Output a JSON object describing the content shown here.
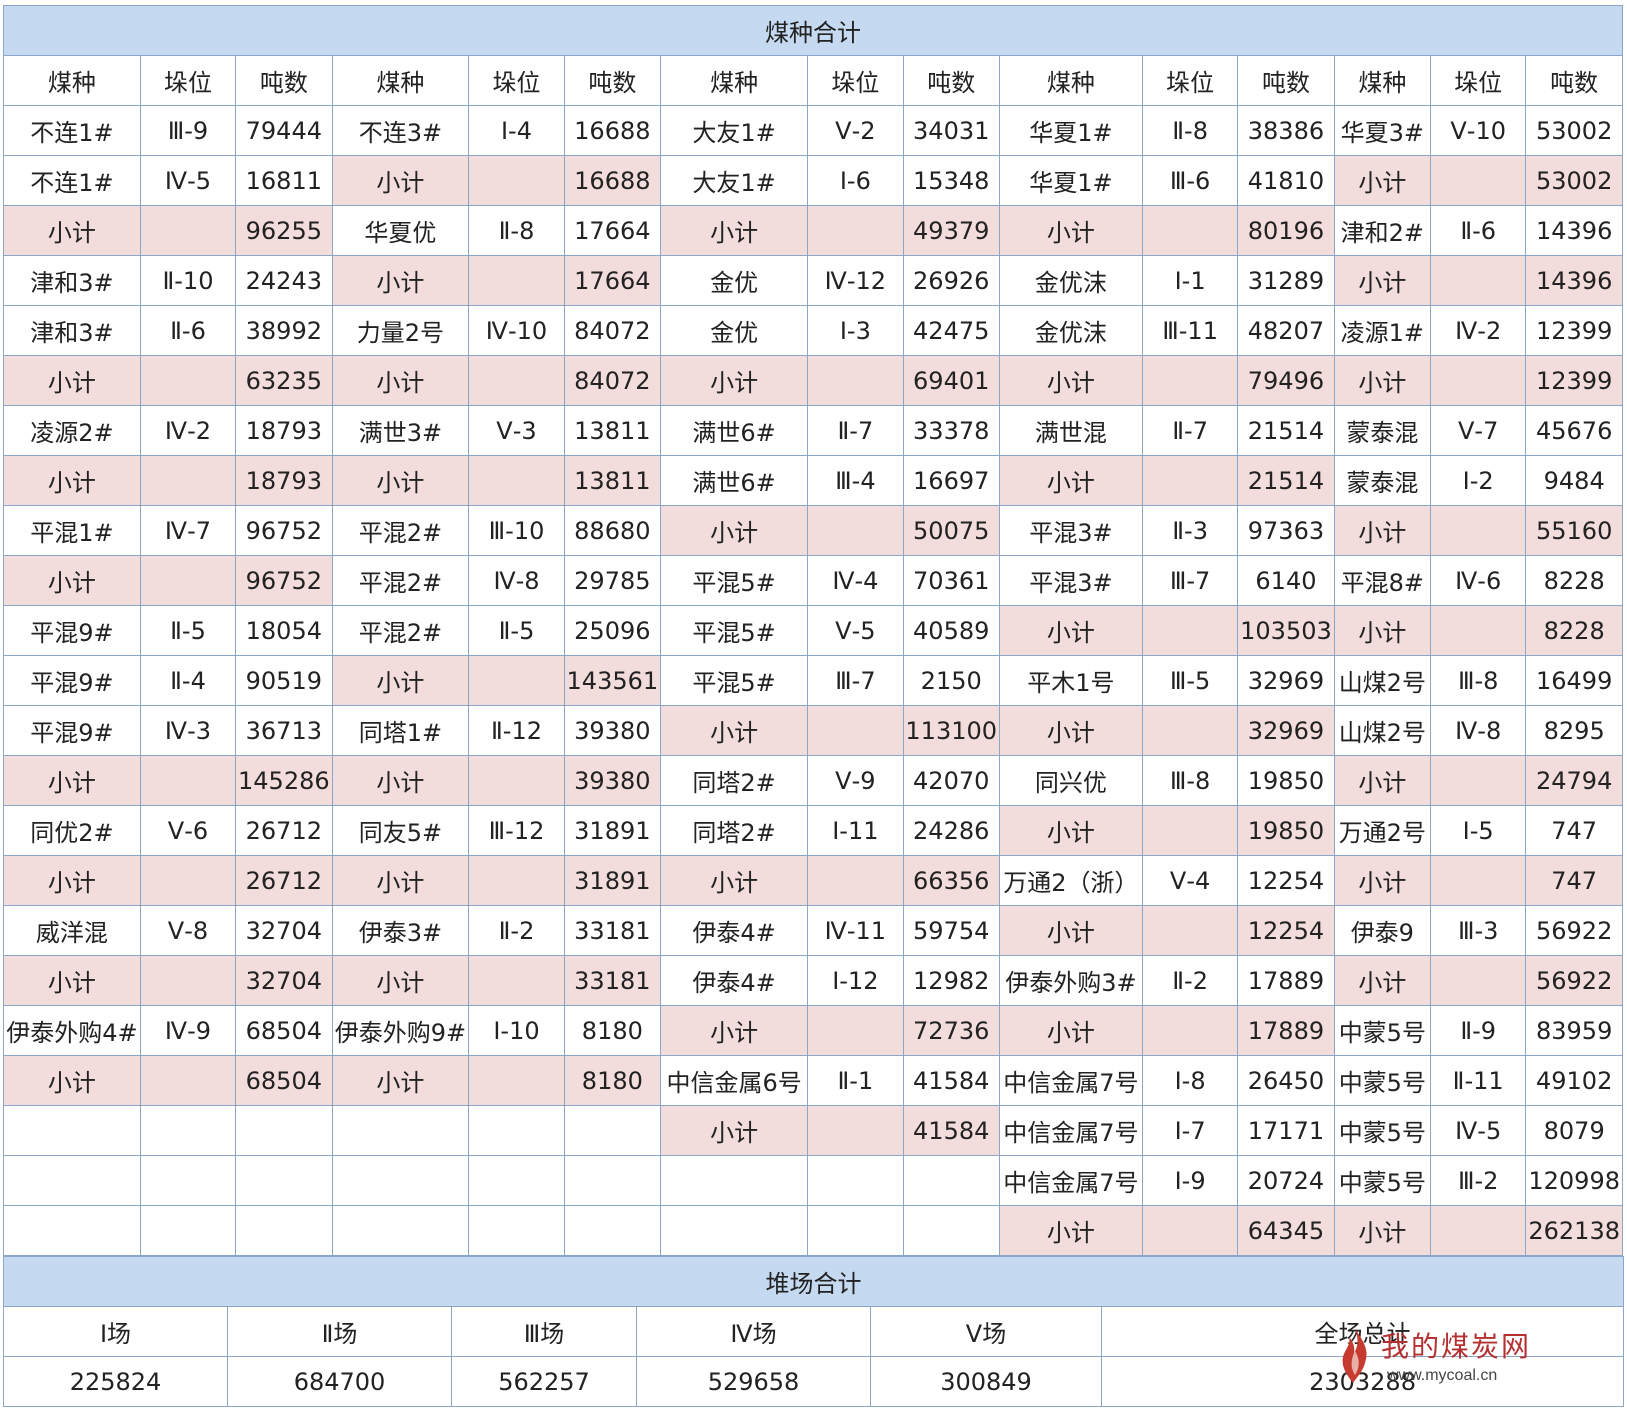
{
  "coal_title": "煤种合计",
  "yard_title": "堆场合计",
  "col_headers": [
    "煤种",
    "垛位",
    "吨数",
    "煤种",
    "垛位",
    "吨数",
    "煤种",
    "垛位",
    "吨数",
    "煤种",
    "垛位",
    "吨数",
    "煤种",
    "垛位",
    "吨数"
  ],
  "rows": [
    [
      [
        "不连1#",
        "Ⅲ-9",
        "79444"
      ],
      [
        "不连3#",
        "Ⅰ-4",
        "16688"
      ],
      [
        "大友1#",
        "Ⅴ-2",
        "34031"
      ],
      [
        "华夏1#",
        "Ⅱ-8",
        "38386"
      ],
      [
        "华夏3#",
        "Ⅴ-10",
        "53002"
      ]
    ],
    [
      [
        "不连1#",
        "Ⅳ-5",
        "16811"
      ],
      [
        "小计",
        "",
        "16688"
      ],
      [
        "大友1#",
        "Ⅰ-6",
        "15348"
      ],
      [
        "华夏1#",
        "Ⅲ-6",
        "41810"
      ],
      [
        "小计",
        "",
        "53002"
      ]
    ],
    [
      [
        "小计",
        "",
        "96255"
      ],
      [
        "华夏优",
        "Ⅱ-8",
        "17664"
      ],
      [
        "小计",
        "",
        "49379"
      ],
      [
        "小计",
        "",
        "80196"
      ],
      [
        "津和2#",
        "Ⅱ-6",
        "14396"
      ]
    ],
    [
      [
        "津和3#",
        "Ⅱ-10",
        "24243"
      ],
      [
        "小计",
        "",
        "17664"
      ],
      [
        "金优",
        "Ⅳ-12",
        "26926"
      ],
      [
        "金优沫",
        "Ⅰ-1",
        "31289"
      ],
      [
        "小计",
        "",
        "14396"
      ]
    ],
    [
      [
        "津和3#",
        "Ⅱ-6",
        "38992"
      ],
      [
        "力量2号",
        "Ⅳ-10",
        "84072"
      ],
      [
        "金优",
        "Ⅰ-3",
        "42475"
      ],
      [
        "金优沫",
        "Ⅲ-11",
        "48207"
      ],
      [
        "凌源1#",
        "Ⅳ-2",
        "12399"
      ]
    ],
    [
      [
        "小计",
        "",
        "63235"
      ],
      [
        "小计",
        "",
        "84072"
      ],
      [
        "小计",
        "",
        "69401"
      ],
      [
        "小计",
        "",
        "79496"
      ],
      [
        "小计",
        "",
        "12399"
      ]
    ],
    [
      [
        "凌源2#",
        "Ⅳ-2",
        "18793"
      ],
      [
        "满世3#",
        "Ⅴ-3",
        "13811"
      ],
      [
        "满世6#",
        "Ⅱ-7",
        "33378"
      ],
      [
        "满世混",
        "Ⅱ-7",
        "21514"
      ],
      [
        "蒙泰混",
        "Ⅴ-7",
        "45676"
      ]
    ],
    [
      [
        "小计",
        "",
        "18793"
      ],
      [
        "小计",
        "",
        "13811"
      ],
      [
        "满世6#",
        "Ⅲ-4",
        "16697"
      ],
      [
        "小计",
        "",
        "21514"
      ],
      [
        "蒙泰混",
        "Ⅰ-2",
        "9484"
      ]
    ],
    [
      [
        "平混1#",
        "Ⅳ-7",
        "96752"
      ],
      [
        "平混2#",
        "Ⅲ-10",
        "88680"
      ],
      [
        "小计",
        "",
        "50075"
      ],
      [
        "平混3#",
        "Ⅱ-3",
        "97363"
      ],
      [
        "小计",
        "",
        "55160"
      ]
    ],
    [
      [
        "小计",
        "",
        "96752"
      ],
      [
        "平混2#",
        "Ⅳ-8",
        "29785"
      ],
      [
        "平混5#",
        "Ⅳ-4",
        "70361"
      ],
      [
        "平混3#",
        "Ⅲ-7",
        "6140"
      ],
      [
        "平混8#",
        "Ⅳ-6",
        "8228"
      ]
    ],
    [
      [
        "平混9#",
        "Ⅱ-5",
        "18054"
      ],
      [
        "平混2#",
        "Ⅱ-5",
        "25096"
      ],
      [
        "平混5#",
        "Ⅴ-5",
        "40589"
      ],
      [
        "小计",
        "",
        "103503"
      ],
      [
        "小计",
        "",
        "8228"
      ]
    ],
    [
      [
        "平混9#",
        "Ⅱ-4",
        "90519"
      ],
      [
        "小计",
        "",
        "143561"
      ],
      [
        "平混5#",
        "Ⅲ-7",
        "2150"
      ],
      [
        "平木1号",
        "Ⅲ-5",
        "32969"
      ],
      [
        "山煤2号",
        "Ⅲ-8",
        "16499"
      ]
    ],
    [
      [
        "平混9#",
        "Ⅳ-3",
        "36713"
      ],
      [
        "同塔1#",
        "Ⅱ-12",
        "39380"
      ],
      [
        "小计",
        "",
        "113100"
      ],
      [
        "小计",
        "",
        "32969"
      ],
      [
        "山煤2号",
        "Ⅳ-8",
        "8295"
      ]
    ],
    [
      [
        "小计",
        "",
        "145286"
      ],
      [
        "小计",
        "",
        "39380"
      ],
      [
        "同塔2#",
        "Ⅴ-9",
        "42070"
      ],
      [
        "同兴优",
        "Ⅲ-8",
        "19850"
      ],
      [
        "小计",
        "",
        "24794"
      ]
    ],
    [
      [
        "同优2#",
        "Ⅴ-6",
        "26712"
      ],
      [
        "同友5#",
        "Ⅲ-12",
        "31891"
      ],
      [
        "同塔2#",
        "Ⅰ-11",
        "24286"
      ],
      [
        "小计",
        "",
        "19850"
      ],
      [
        "万通2号",
        "Ⅰ-5",
        "747"
      ]
    ],
    [
      [
        "小计",
        "",
        "26712"
      ],
      [
        "小计",
        "",
        "31891"
      ],
      [
        "小计",
        "",
        "66356"
      ],
      [
        "万通2（浙）",
        "Ⅴ-4",
        "12254"
      ],
      [
        "小计",
        "",
        "747"
      ]
    ],
    [
      [
        "威洋混",
        "Ⅴ-8",
        "32704"
      ],
      [
        "伊泰3#",
        "Ⅱ-2",
        "33181"
      ],
      [
        "伊泰4#",
        "Ⅳ-11",
        "59754"
      ],
      [
        "小计",
        "",
        "12254"
      ],
      [
        "伊泰9",
        "Ⅲ-3",
        "56922"
      ]
    ],
    [
      [
        "小计",
        "",
        "32704"
      ],
      [
        "小计",
        "",
        "33181"
      ],
      [
        "伊泰4#",
        "Ⅰ-12",
        "12982"
      ],
      [
        "伊泰外购3#",
        "Ⅱ-2",
        "17889"
      ],
      [
        "小计",
        "",
        "56922"
      ]
    ],
    [
      [
        "伊泰外购4#",
        "Ⅳ-9",
        "68504"
      ],
      [
        "伊泰外购9#",
        "Ⅰ-10",
        "8180"
      ],
      [
        "小计",
        "",
        "72736"
      ],
      [
        "小计",
        "",
        "17889"
      ],
      [
        "中蒙5号",
        "Ⅱ-9",
        "83959"
      ]
    ],
    [
      [
        "小计",
        "",
        "68504"
      ],
      [
        "小计",
        "",
        "8180"
      ],
      [
        "中信金属6号",
        "Ⅱ-1",
        "41584"
      ],
      [
        "中信金属7号",
        "Ⅰ-8",
        "26450"
      ],
      [
        "中蒙5号",
        "Ⅱ-11",
        "49102"
      ]
    ],
    [
      [
        "",
        "",
        ""
      ],
      [
        "",
        "",
        ""
      ],
      [
        "小计",
        "",
        "41584"
      ],
      [
        "中信金属7号",
        "Ⅰ-7",
        "17171"
      ],
      [
        "中蒙5号",
        "Ⅳ-5",
        "8079"
      ]
    ],
    [
      [
        "",
        "",
        ""
      ],
      [
        "",
        "",
        ""
      ],
      [
        "",
        "",
        ""
      ],
      [
        "中信金属7号",
        "Ⅰ-9",
        "20724"
      ],
      [
        "中蒙5号",
        "Ⅲ-2",
        "120998"
      ]
    ],
    [
      [
        "",
        "",
        ""
      ],
      [
        "",
        "",
        ""
      ],
      [
        "",
        "",
        ""
      ],
      [
        "小计",
        "",
        "64345"
      ],
      [
        "小计",
        "",
        "262138"
      ]
    ]
  ],
  "yard_headers": [
    "Ⅰ场",
    "Ⅱ场",
    "Ⅲ场",
    "Ⅳ场",
    "Ⅴ场",
    "全场总计"
  ],
  "yard_values": [
    "225824",
    "684700",
    "562257",
    "529658",
    "300849",
    "2303288"
  ],
  "watermark": {
    "name": "我的煤炭网",
    "url": "www.mycoal.cn",
    "icon": "flame-logo-icon"
  },
  "colors": {
    "header_bg": "#c5d9f1",
    "subtotal_bg": "#f2dcdc",
    "border": "#8aa6c8",
    "brand": "#b53131"
  }
}
